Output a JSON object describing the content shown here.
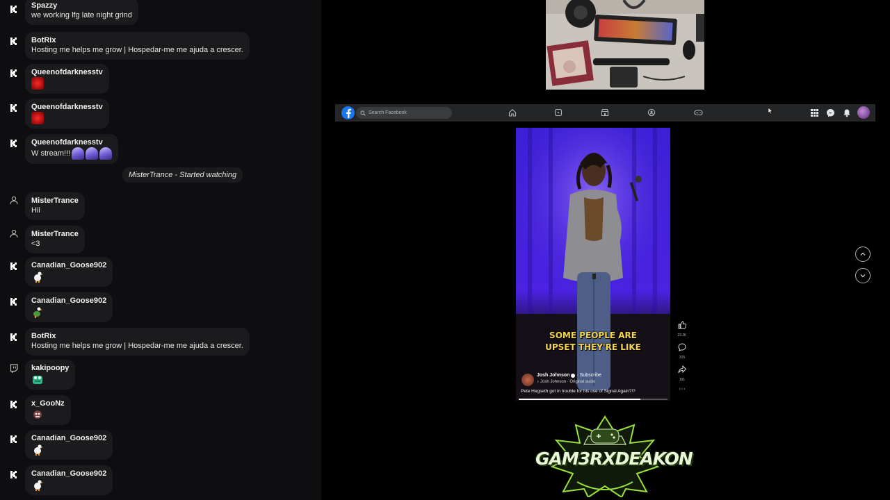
{
  "chat": {
    "messages": [
      {
        "platform": "kick",
        "user": "Spazzy",
        "text": "we working lfg late night grind",
        "emotes": []
      },
      {
        "platform": "kick",
        "user": "BotRix",
        "text": "Hosting me helps me grow | Hospedar-me me ajuda a crescer.",
        "emotes": []
      },
      {
        "platform": "kick",
        "user": "Queenofdarknesstv",
        "text": "",
        "emotes": [
          "red-emote"
        ]
      },
      {
        "platform": "kick",
        "user": "Queenofdarknesstv",
        "text": "",
        "emotes": [
          "red-emote"
        ]
      },
      {
        "platform": "kick",
        "user": "Queenofdarknesstv",
        "text": "W stream!!!",
        "emotes": [
          "wizard-emote",
          "wizard-emote",
          "wizard-emote"
        ]
      },
      {
        "platform": "viewer",
        "user": "MisterTrance",
        "text": "Hii",
        "emotes": []
      },
      {
        "platform": "viewer",
        "user": "MisterTrance",
        "text": "<3",
        "emotes": []
      },
      {
        "platform": "kick",
        "user": "Canadian_Goose902",
        "text": "",
        "emotes": [
          "goose-emote"
        ]
      },
      {
        "platform": "kick",
        "user": "Canadian_Goose902",
        "text": "",
        "emotes": [
          "goose-dance-emote"
        ]
      },
      {
        "platform": "kick",
        "user": "BotRix",
        "text": "Hosting me helps me grow | Hospedar-me me ajuda a crescer.",
        "emotes": []
      },
      {
        "platform": "twitch",
        "user": "kakipoopy",
        "text": "",
        "emotes": [
          "frog-emote"
        ]
      },
      {
        "platform": "kick",
        "user": "x_GooNz",
        "text": "",
        "emotes": [
          "monster-emote"
        ]
      },
      {
        "platform": "kick",
        "user": "Canadian_Goose902",
        "text": "",
        "emotes": [
          "goose-emote"
        ]
      },
      {
        "platform": "kick",
        "user": "Canadian_Goose902",
        "text": "",
        "emotes": [
          "goose-emote"
        ]
      }
    ],
    "system_event": "MisterTrance - Started watching"
  },
  "facebook": {
    "search_placeholder": "Search Facebook",
    "nav_icons": [
      "home-icon",
      "reels-icon",
      "marketplace-icon",
      "groups-icon",
      "gaming-icon"
    ],
    "right_icons": [
      "menu-grid-icon",
      "messenger-icon",
      "notifications-icon",
      "profile-avatar"
    ]
  },
  "reel": {
    "caption_line1": "SOME PEOPLE ARE",
    "caption_line2": "UPSET THEY'RE LIKE",
    "author": "Josh Johnson",
    "subscribe": "· Subscribe",
    "audio": "Josh Johnson · Original audio",
    "description": "Pete Hegseth got in trouble for his use of Signal Again?!?",
    "likes": "23.2K",
    "comments": "315",
    "shares": "191",
    "progress": 0.82
  },
  "overlay": {
    "logo_text": "GAM3RXDEAKON"
  },
  "colors": {
    "chat_bg": "#0e0e10",
    "bubble_bg": "#1b1b1d",
    "facebook_blue": "#1877f2",
    "caption_yellow": "#f5d64a",
    "logo_green": "#9be13a"
  }
}
